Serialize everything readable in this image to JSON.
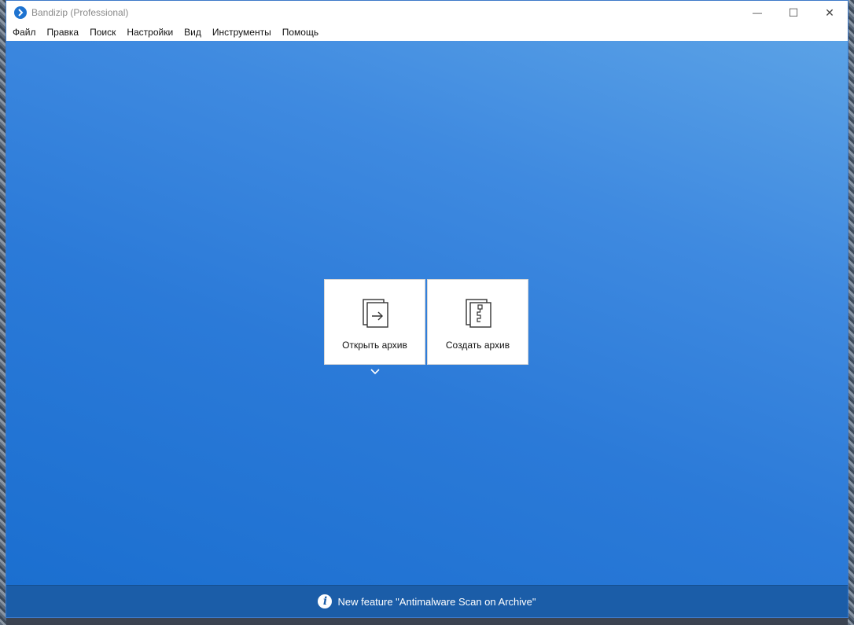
{
  "window": {
    "title": "Bandizip (Professional)",
    "controls": {
      "minimize": "—",
      "maximize": "☐",
      "close": "✕"
    }
  },
  "menu": {
    "items": [
      {
        "label": "Файл"
      },
      {
        "label": "Правка"
      },
      {
        "label": "Поиск"
      },
      {
        "label": "Настройки"
      },
      {
        "label": "Вид"
      },
      {
        "label": "Инструменты"
      },
      {
        "label": "Помощь"
      }
    ]
  },
  "tiles": {
    "open_label": "Открыть архив",
    "create_label": "Создать архив",
    "open_icon": "open-archive-icon",
    "create_icon": "create-archive-icon"
  },
  "status": {
    "message": "New feature \"Antimalware Scan on Archive\"",
    "icon": "info-icon"
  },
  "colors": {
    "accent": "#1e73d0",
    "background_top": "#5ba2e6",
    "background_bottom": "#1b6fd0",
    "statusbar": "#1b5da8"
  }
}
